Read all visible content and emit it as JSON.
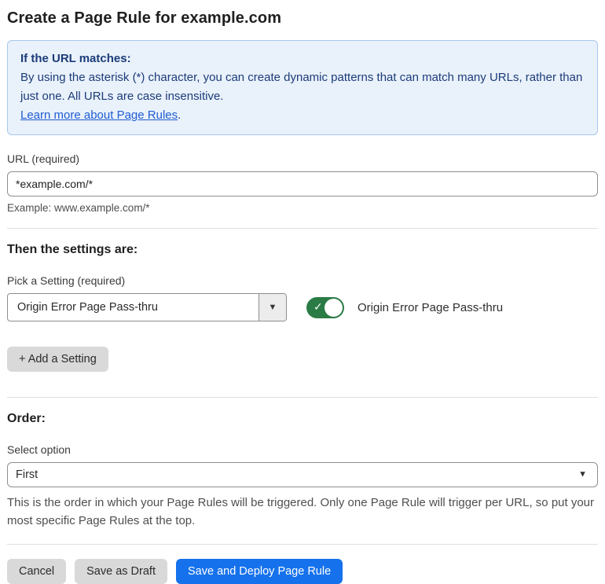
{
  "page": {
    "title": "Create a Page Rule for example.com"
  },
  "info_box": {
    "heading": "If the URL matches:",
    "body": "By using the asterisk (*) character, you can create dynamic patterns that can match many URLs, rather than just one. All URLs are case insensitive.",
    "link_text": "Learn more about Page Rules",
    "link_suffix": "."
  },
  "url_section": {
    "label": "URL (required)",
    "value": "*example.com/*",
    "helper": "Example: www.example.com/*"
  },
  "settings_section": {
    "heading": "Then the settings are:",
    "picker_label": "Pick a Setting (required)",
    "picker_value": "Origin Error Page Pass-thru",
    "toggle_state": "on",
    "toggle_check": "✓",
    "toggle_label": "Origin Error Page Pass-thru",
    "add_button_label": "+ Add a Setting"
  },
  "order_section": {
    "heading": "Order:",
    "select_label": "Select option",
    "select_value": "First",
    "helper": "This is the order in which your Page Rules will be triggered. Only one Page Rule will trigger per URL, so put your most specific Page Rules at the top."
  },
  "footer": {
    "cancel_label": "Cancel",
    "save_draft_label": "Save as Draft",
    "save_deploy_label": "Save and Deploy Page Rule"
  },
  "icons": {
    "chevron_down": "▼"
  },
  "colors": {
    "info_bg": "#e9f1fb",
    "info_border": "#a7c7ee",
    "info_text": "#1c3c78",
    "link_blue": "#1f5dd1",
    "toggle_green": "#2a7b45",
    "primary_blue": "#1672ec",
    "button_gray": "#d9d9d9",
    "border_gray": "#8f8f8f",
    "divider_gray": "#e0e0e0"
  }
}
